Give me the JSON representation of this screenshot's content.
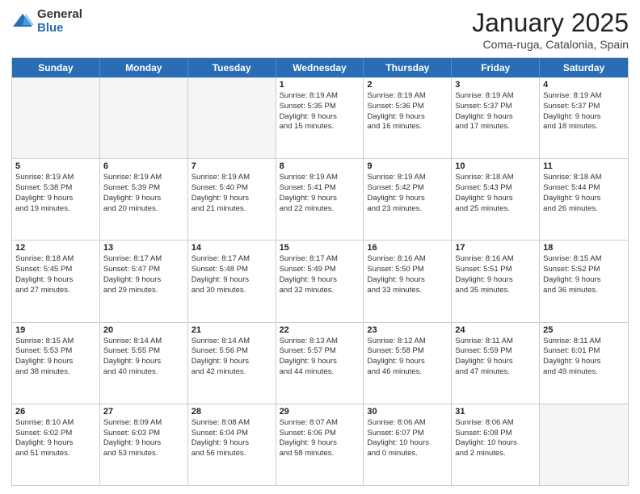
{
  "header": {
    "logo_general": "General",
    "logo_blue": "Blue",
    "month_title": "January 2025",
    "location": "Coma-ruga, Catalonia, Spain"
  },
  "weekdays": [
    "Sunday",
    "Monday",
    "Tuesday",
    "Wednesday",
    "Thursday",
    "Friday",
    "Saturday"
  ],
  "rows": [
    [
      {
        "day": "",
        "lines": [],
        "empty": true
      },
      {
        "day": "",
        "lines": [],
        "empty": true
      },
      {
        "day": "",
        "lines": [],
        "empty": true
      },
      {
        "day": "1",
        "lines": [
          "Sunrise: 8:19 AM",
          "Sunset: 5:35 PM",
          "Daylight: 9 hours",
          "and 15 minutes."
        ]
      },
      {
        "day": "2",
        "lines": [
          "Sunrise: 8:19 AM",
          "Sunset: 5:36 PM",
          "Daylight: 9 hours",
          "and 16 minutes."
        ]
      },
      {
        "day": "3",
        "lines": [
          "Sunrise: 8:19 AM",
          "Sunset: 5:37 PM",
          "Daylight: 9 hours",
          "and 17 minutes."
        ]
      },
      {
        "day": "4",
        "lines": [
          "Sunrise: 8:19 AM",
          "Sunset: 5:37 PM",
          "Daylight: 9 hours",
          "and 18 minutes."
        ]
      }
    ],
    [
      {
        "day": "5",
        "lines": [
          "Sunrise: 8:19 AM",
          "Sunset: 5:38 PM",
          "Daylight: 9 hours",
          "and 19 minutes."
        ]
      },
      {
        "day": "6",
        "lines": [
          "Sunrise: 8:19 AM",
          "Sunset: 5:39 PM",
          "Daylight: 9 hours",
          "and 20 minutes."
        ]
      },
      {
        "day": "7",
        "lines": [
          "Sunrise: 8:19 AM",
          "Sunset: 5:40 PM",
          "Daylight: 9 hours",
          "and 21 minutes."
        ]
      },
      {
        "day": "8",
        "lines": [
          "Sunrise: 8:19 AM",
          "Sunset: 5:41 PM",
          "Daylight: 9 hours",
          "and 22 minutes."
        ]
      },
      {
        "day": "9",
        "lines": [
          "Sunrise: 8:19 AM",
          "Sunset: 5:42 PM",
          "Daylight: 9 hours",
          "and 23 minutes."
        ]
      },
      {
        "day": "10",
        "lines": [
          "Sunrise: 8:18 AM",
          "Sunset: 5:43 PM",
          "Daylight: 9 hours",
          "and 25 minutes."
        ]
      },
      {
        "day": "11",
        "lines": [
          "Sunrise: 8:18 AM",
          "Sunset: 5:44 PM",
          "Daylight: 9 hours",
          "and 26 minutes."
        ]
      }
    ],
    [
      {
        "day": "12",
        "lines": [
          "Sunrise: 8:18 AM",
          "Sunset: 5:45 PM",
          "Daylight: 9 hours",
          "and 27 minutes."
        ]
      },
      {
        "day": "13",
        "lines": [
          "Sunrise: 8:17 AM",
          "Sunset: 5:47 PM",
          "Daylight: 9 hours",
          "and 29 minutes."
        ]
      },
      {
        "day": "14",
        "lines": [
          "Sunrise: 8:17 AM",
          "Sunset: 5:48 PM",
          "Daylight: 9 hours",
          "and 30 minutes."
        ]
      },
      {
        "day": "15",
        "lines": [
          "Sunrise: 8:17 AM",
          "Sunset: 5:49 PM",
          "Daylight: 9 hours",
          "and 32 minutes."
        ]
      },
      {
        "day": "16",
        "lines": [
          "Sunrise: 8:16 AM",
          "Sunset: 5:50 PM",
          "Daylight: 9 hours",
          "and 33 minutes."
        ]
      },
      {
        "day": "17",
        "lines": [
          "Sunrise: 8:16 AM",
          "Sunset: 5:51 PM",
          "Daylight: 9 hours",
          "and 35 minutes."
        ]
      },
      {
        "day": "18",
        "lines": [
          "Sunrise: 8:15 AM",
          "Sunset: 5:52 PM",
          "Daylight: 9 hours",
          "and 36 minutes."
        ]
      }
    ],
    [
      {
        "day": "19",
        "lines": [
          "Sunrise: 8:15 AM",
          "Sunset: 5:53 PM",
          "Daylight: 9 hours",
          "and 38 minutes."
        ]
      },
      {
        "day": "20",
        "lines": [
          "Sunrise: 8:14 AM",
          "Sunset: 5:55 PM",
          "Daylight: 9 hours",
          "and 40 minutes."
        ]
      },
      {
        "day": "21",
        "lines": [
          "Sunrise: 8:14 AM",
          "Sunset: 5:56 PM",
          "Daylight: 9 hours",
          "and 42 minutes."
        ]
      },
      {
        "day": "22",
        "lines": [
          "Sunrise: 8:13 AM",
          "Sunset: 5:57 PM",
          "Daylight: 9 hours",
          "and 44 minutes."
        ]
      },
      {
        "day": "23",
        "lines": [
          "Sunrise: 8:12 AM",
          "Sunset: 5:58 PM",
          "Daylight: 9 hours",
          "and 46 minutes."
        ]
      },
      {
        "day": "24",
        "lines": [
          "Sunrise: 8:11 AM",
          "Sunset: 5:59 PM",
          "Daylight: 9 hours",
          "and 47 minutes."
        ]
      },
      {
        "day": "25",
        "lines": [
          "Sunrise: 8:11 AM",
          "Sunset: 6:01 PM",
          "Daylight: 9 hours",
          "and 49 minutes."
        ]
      }
    ],
    [
      {
        "day": "26",
        "lines": [
          "Sunrise: 8:10 AM",
          "Sunset: 6:02 PM",
          "Daylight: 9 hours",
          "and 51 minutes."
        ]
      },
      {
        "day": "27",
        "lines": [
          "Sunrise: 8:09 AM",
          "Sunset: 6:03 PM",
          "Daylight: 9 hours",
          "and 53 minutes."
        ]
      },
      {
        "day": "28",
        "lines": [
          "Sunrise: 8:08 AM",
          "Sunset: 6:04 PM",
          "Daylight: 9 hours",
          "and 56 minutes."
        ]
      },
      {
        "day": "29",
        "lines": [
          "Sunrise: 8:07 AM",
          "Sunset: 6:06 PM",
          "Daylight: 9 hours",
          "and 58 minutes."
        ]
      },
      {
        "day": "30",
        "lines": [
          "Sunrise: 8:06 AM",
          "Sunset: 6:07 PM",
          "Daylight: 10 hours",
          "and 0 minutes."
        ]
      },
      {
        "day": "31",
        "lines": [
          "Sunrise: 8:06 AM",
          "Sunset: 6:08 PM",
          "Daylight: 10 hours",
          "and 2 minutes."
        ]
      },
      {
        "day": "",
        "lines": [],
        "empty": true
      }
    ]
  ]
}
